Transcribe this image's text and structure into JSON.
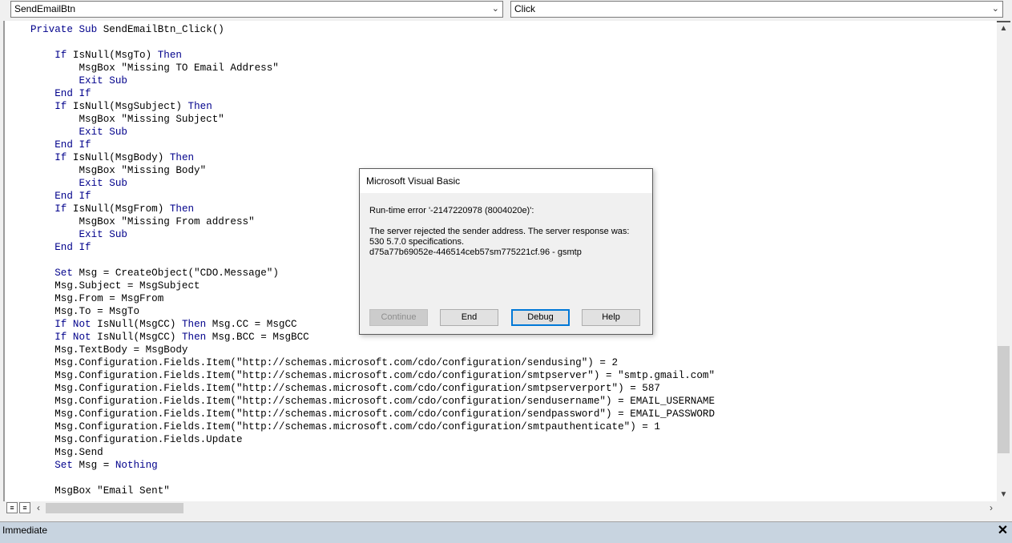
{
  "object_combo": {
    "value": "SendEmailBtn"
  },
  "procedure_combo": {
    "value": "Click"
  },
  "code_lines": [
    "Private Sub SendEmailBtn_Click()",
    "",
    "    If IsNull(MsgTo) Then",
    "        MsgBox \"Missing TO Email Address\"",
    "        Exit Sub",
    "    End If",
    "    If IsNull(MsgSubject) Then",
    "        MsgBox \"Missing Subject\"",
    "        Exit Sub",
    "    End If",
    "    If IsNull(MsgBody) Then",
    "        MsgBox \"Missing Body\"",
    "        Exit Sub",
    "    End If",
    "    If IsNull(MsgFrom) Then",
    "        MsgBox \"Missing From address\"",
    "        Exit Sub",
    "    End If",
    "",
    "    Set Msg = CreateObject(\"CDO.Message\")",
    "    Msg.Subject = MsgSubject",
    "    Msg.From = MsgFrom",
    "    Msg.To = MsgTo",
    "    If Not IsNull(MsgCC) Then Msg.CC = MsgCC",
    "    If Not IsNull(MsgCC) Then Msg.BCC = MsgBCC",
    "    Msg.TextBody = MsgBody",
    "    Msg.Configuration.Fields.Item(\"http://schemas.microsoft.com/cdo/configuration/sendusing\") = 2",
    "    Msg.Configuration.Fields.Item(\"http://schemas.microsoft.com/cdo/configuration/smtpserver\") = \"smtp.gmail.com\"",
    "    Msg.Configuration.Fields.Item(\"http://schemas.microsoft.com/cdo/configuration/smtpserverport\") = 587",
    "    Msg.Configuration.Fields.Item(\"http://schemas.microsoft.com/cdo/configuration/sendusername\") = EMAIL_USERNAME",
    "    Msg.Configuration.Fields.Item(\"http://schemas.microsoft.com/cdo/configuration/sendpassword\") = EMAIL_PASSWORD",
    "    Msg.Configuration.Fields.Item(\"http://schemas.microsoft.com/cdo/configuration/smtpauthenticate\") = 1",
    "    Msg.Configuration.Fields.Update",
    "    Msg.Send",
    "    Set Msg = Nothing",
    "",
    "    MsgBox \"Email Sent\""
  ],
  "keywords": [
    "Private",
    "Sub",
    "If",
    "Then",
    "Exit",
    "End",
    "Set",
    "Not",
    "Nothing"
  ],
  "keyword_color": "#00008b",
  "dialog": {
    "title": "Microsoft Visual Basic",
    "error_line": "Run-time error '-2147220978 (8004020e)':",
    "detail_lines": [
      "The server rejected the sender address. The server response was:",
      "530 5.7.0 specifications.",
      "d75a77b69052e-446514ceb57sm775221cf.96 - gsmtp"
    ],
    "buttons": {
      "continue": "Continue",
      "end": "End",
      "debug": "Debug",
      "help": "Help"
    }
  },
  "immediate": {
    "title": "Immediate"
  },
  "icons": {
    "dropdown": "chevron-down-icon",
    "close": "close-icon",
    "scroll_up": "arrow-up-icon",
    "scroll_down": "arrow-down-icon",
    "scroll_left": "arrow-left-icon",
    "scroll_right": "arrow-right-icon"
  }
}
